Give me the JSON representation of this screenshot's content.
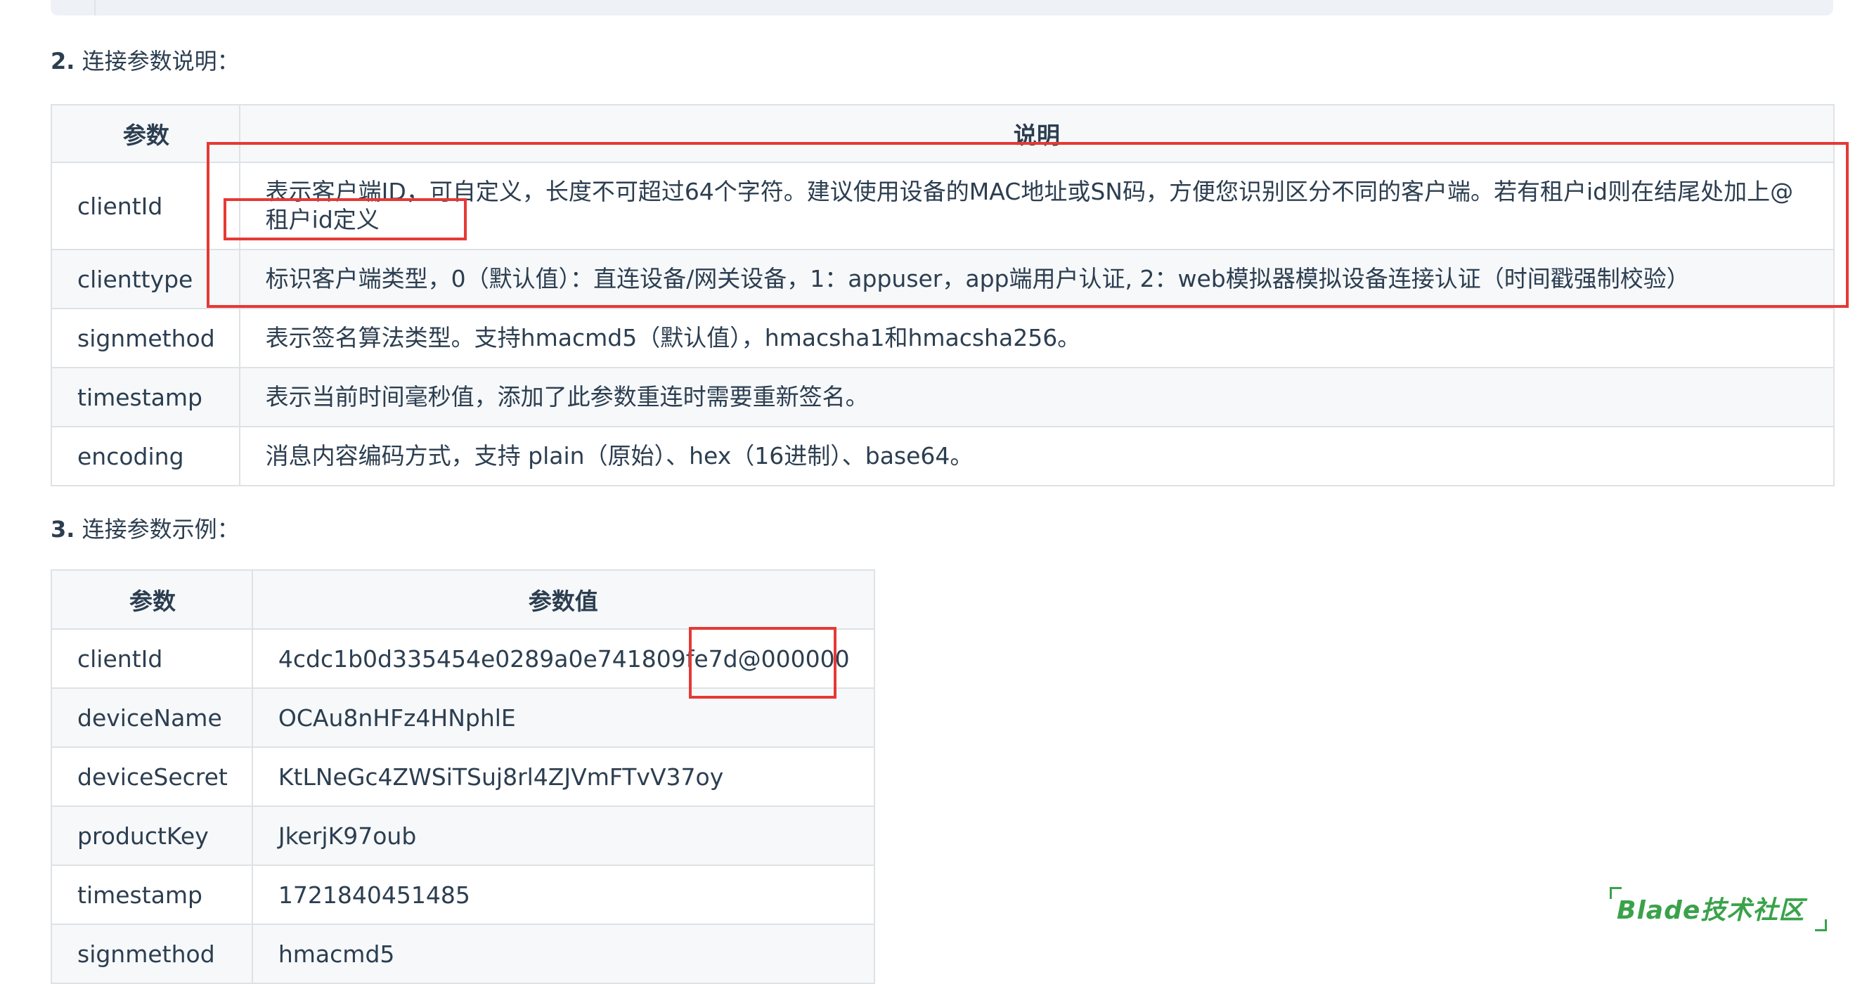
{
  "section2": {
    "number": "2.",
    "title": "连接参数说明："
  },
  "table1": {
    "headers": [
      "参数",
      "说明"
    ],
    "rows": [
      {
        "param": "clientId",
        "desc": "表示客户端ID，可自定义，长度不可超过64个字符。建议使用设备的MAC地址或SN码，方便您识别区分不同的客户端。若有租户id则在结尾处加上@租户id定义"
      },
      {
        "param": "clienttype",
        "desc": "标识客户端类型，0（默认值）：直连设备/网关设备，1：appuser，app端用户认证, 2：web模拟器模拟设备连接认证（时间戳强制校验）"
      },
      {
        "param": "signmethod",
        "desc": "表示签名算法类型。支持hmacmd5（默认值），hmacsha1和hmacsha256。"
      },
      {
        "param": "timestamp",
        "desc": "表示当前时间毫秒值，添加了此参数重连时需要重新签名。"
      },
      {
        "param": "encoding",
        "desc": "消息内容编码方式，支持 plain（原始）、hex（16进制）、base64。"
      }
    ]
  },
  "section3": {
    "number": "3.",
    "title": "连接参数示例："
  },
  "table2": {
    "headers": [
      "参数",
      "参数值"
    ],
    "rows": [
      {
        "param": "clientId",
        "value": "4cdc1b0d335454e0289a0e741809fe7d@000000"
      },
      {
        "param": "deviceName",
        "value": "OCAu8nHFz4HNphlE"
      },
      {
        "param": "deviceSecret",
        "value": "KtLNeGc4ZWSiTSuj8rl4ZJVmFTvV37oy"
      },
      {
        "param": "productKey",
        "value": "JkerjK97oub"
      },
      {
        "param": "timestamp",
        "value": "1721840451485"
      },
      {
        "param": "signmethod",
        "value": "hmacmd5"
      }
    ]
  },
  "watermark": "Blade技术社区",
  "colors": {
    "highlight": "#e53935",
    "watermark": "#3aa24a",
    "border": "#dfe2e5",
    "stripe": "#f6f8fa"
  }
}
